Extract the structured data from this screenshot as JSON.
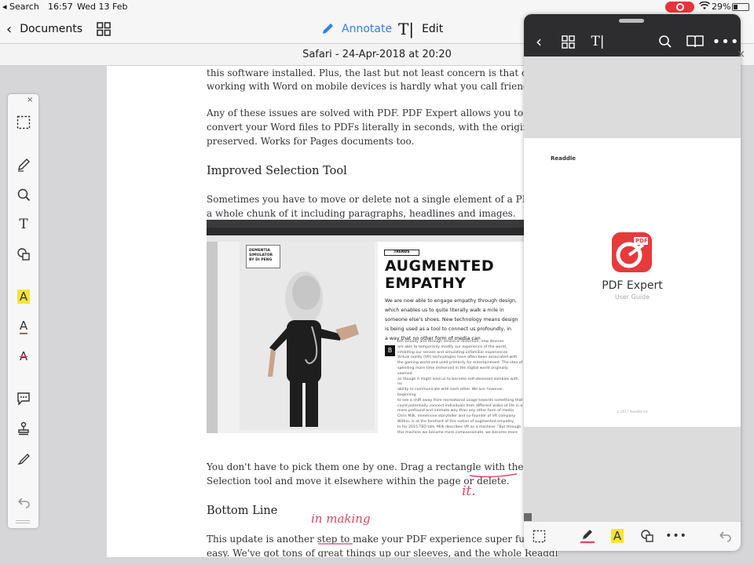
{
  "status_bar": {
    "back_app": "◂ Search",
    "time": "16:57",
    "date": "Wed 13 Feb",
    "battery": "29%"
  },
  "toolbar": {
    "documents_label": "Documents",
    "annotate_label": "Annotate",
    "edit_label": "Edit"
  },
  "document": {
    "title": "Safari - 24-Apr-2018 at 20:20",
    "para1_line1": "this software installed. Plus, the last but not least concern is that opening and",
    "para1_line2": "working with Word on mobile devices is hardly what you call friendly.",
    "para2_line1": "Any of these issues are solved with PDF. PDF Expert allows you to intelligently",
    "para2_line2": "convert your Word files to PDFs literally in seconds, with the original formatting",
    "para2_line3": "preserved. Works for Pages documents too.",
    "heading1": "Improved Selection Tool",
    "para3_line1": "Sometimes you have to move or delete not a single element of a PDF document, but",
    "para3_line2": "a whole chunk of it including paragraphs, headlines and images.",
    "para4_line1": "You don't have to pick them one by one. Drag a rectangle with the renewed",
    "para4_line2": "Selection tool and move it elsewhere within the page or delete.",
    "heading2": "Bottom Line",
    "para5_line1": "This update is another step to make your PDF experience super functional and",
    "para5_line2": "easy. We've got tons of great things up our sleeves, and the whole Readdle team",
    "ink_it": "it.",
    "ink_making": "in making"
  },
  "figure": {
    "dementia": "DEMENTIA\nSIMULATOR\nBY DI PENG",
    "trends": "TRENDS",
    "headline1": "AUGMENTED",
    "headline2": "EMPATHY",
    "body": "We are now able to engage empathy through design,\nwhich enables us to quite literally walk a mile in\nsomeone else's shoes. New technology means design\nis being used as a tool to connect us profoundly, in\na way that no other form of media can",
    "dropcap": "B",
    "small_text": "oth visually and through sensorial distortion, new devices\nare able to temporarily modify our experience of the world,\ninhibiting our senses and simulating unfamiliar experiences.\nVirtual reality (VR) technologies have often been associated with\nthe gaming world and used primarily for entertainment. The idea of\nspending more time immersed in the digital world originally seemed\nas though it might lead us to become self-obsessed zombies with no\nability to communicate with each other. We are, however, beginning\nto see a shift away from recreational usage towards something that\ncould potentially connect individuals from different walks of life in a\nmore profound and intimate way than any other form of media.\nChris Milk, immersive storyteller and co-founder of VR company\nWithin, is at the forefront of this notion of augmented empathy.\nIn his 2015 TED talk, Milk describes VR as a machine: \"But through\nthis machine we become more compassionate, we become more"
  },
  "panel": {
    "brand": "Readdle",
    "app_name": "PDF Expert",
    "subtitle": "User Guide",
    "pdf_badge": "PDF",
    "copyright": "© 2017 Readdle Inc."
  }
}
